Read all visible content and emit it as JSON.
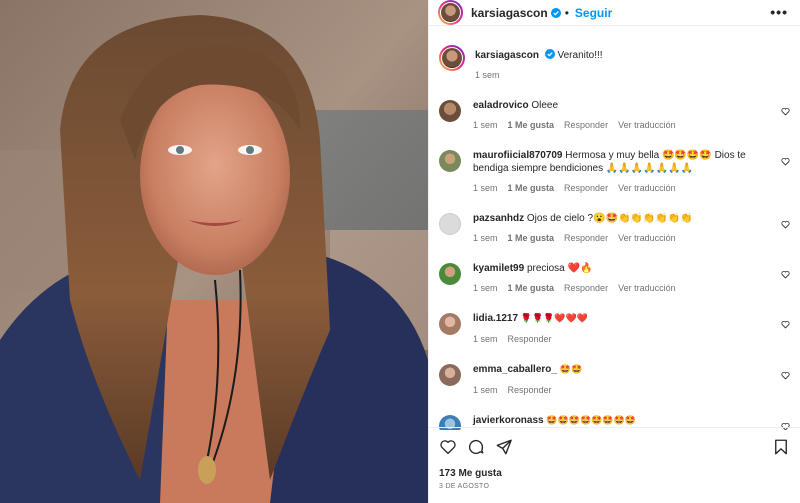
{
  "post": {
    "header": {
      "username": "karsiagascon",
      "separator": "•",
      "follow_label": "Seguir",
      "more_icon": "more-icon"
    },
    "caption": {
      "username": "karsiagascon",
      "text": "Veranito!!!",
      "time": "1 sem"
    },
    "comments": [
      {
        "username": "ealadrovico",
        "text": "Oleee",
        "time": "1 sem",
        "likes": "1 Me gusta",
        "reply": "Responder",
        "translate": "Ver traducción",
        "avatar_color": "#6b4d3a"
      },
      {
        "username": "maurofiicial870709",
        "text": "Hermosa y muy bella 🤩🤩🤩🤩 Dios te bendiga siempre bendiciones 🙏🙏🙏🙏🙏🙏🙏",
        "time": "1 sem",
        "likes": "1 Me gusta",
        "reply": "Responder",
        "translate": "Ver traducción",
        "avatar_color": "#7b8a5c"
      },
      {
        "username": "pazsanhdz",
        "text": "Ojos de cielo ?😮🤩👏👏👏👏👏👏",
        "time": "1 sem",
        "likes": "1 Me gusta",
        "reply": "Responder",
        "translate": "Ver traducción",
        "avatar_color": "#dbdbdb"
      },
      {
        "username": "kyamilet99",
        "text": "preciosa ❤️🔥",
        "time": "1 sem",
        "likes": "1 Me gusta",
        "reply": "Responder",
        "translate": "Ver traducción",
        "avatar_color": "#4a8a3a"
      },
      {
        "username": "lidia.1217",
        "text": "🌹🌹🌹❤️❤️❤️",
        "time": "1 sem",
        "likes": "",
        "reply": "Responder",
        "translate": "",
        "avatar_color": "#a57a64"
      },
      {
        "username": "emma_caballero_",
        "text": "🤩🤩",
        "time": "1 sem",
        "likes": "",
        "reply": "Responder",
        "translate": "",
        "avatar_color": "#8a6a5c"
      },
      {
        "username": "javierkoronass",
        "text": "🤩🤩🤩🤩🤩🤩🤩🤩",
        "time": "",
        "likes": "",
        "reply": "",
        "translate": "",
        "avatar_color": "#3d7fb5"
      }
    ],
    "likes_count": "173 Me gusta",
    "date": "3 DE AGOSTO"
  },
  "colors": {
    "accent": "#0095f6",
    "verified": "#0095f6",
    "muted": "#737373"
  }
}
